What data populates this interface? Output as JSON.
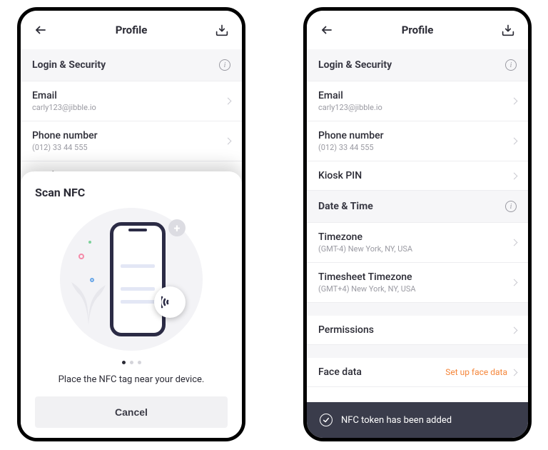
{
  "header": {
    "title": "Profile"
  },
  "sections": {
    "login": {
      "title": "Login & Security",
      "email_label": "Email",
      "email_value": "carly123@jibble.io",
      "phone_label": "Phone number",
      "phone_value": "(012) 33 44 555",
      "kiosk_label": "Kiosk PIN"
    },
    "datetime": {
      "title": "Date & Time",
      "tz_label": "Timezone",
      "tz_value": "(GMT-4) New York, NY, USA",
      "ts_label": "Timesheet Timezone",
      "ts_value": "(GMT+4) New York, NY, USA"
    },
    "permissions": {
      "label": "Permissions"
    },
    "facedata": {
      "label": "Face data",
      "action": "Set up face data"
    }
  },
  "sheet": {
    "title": "Scan NFC",
    "instruction": "Place the NFC tag near your device.",
    "cancel": "Cancel"
  },
  "toast": {
    "message": "NFC token has been added"
  }
}
